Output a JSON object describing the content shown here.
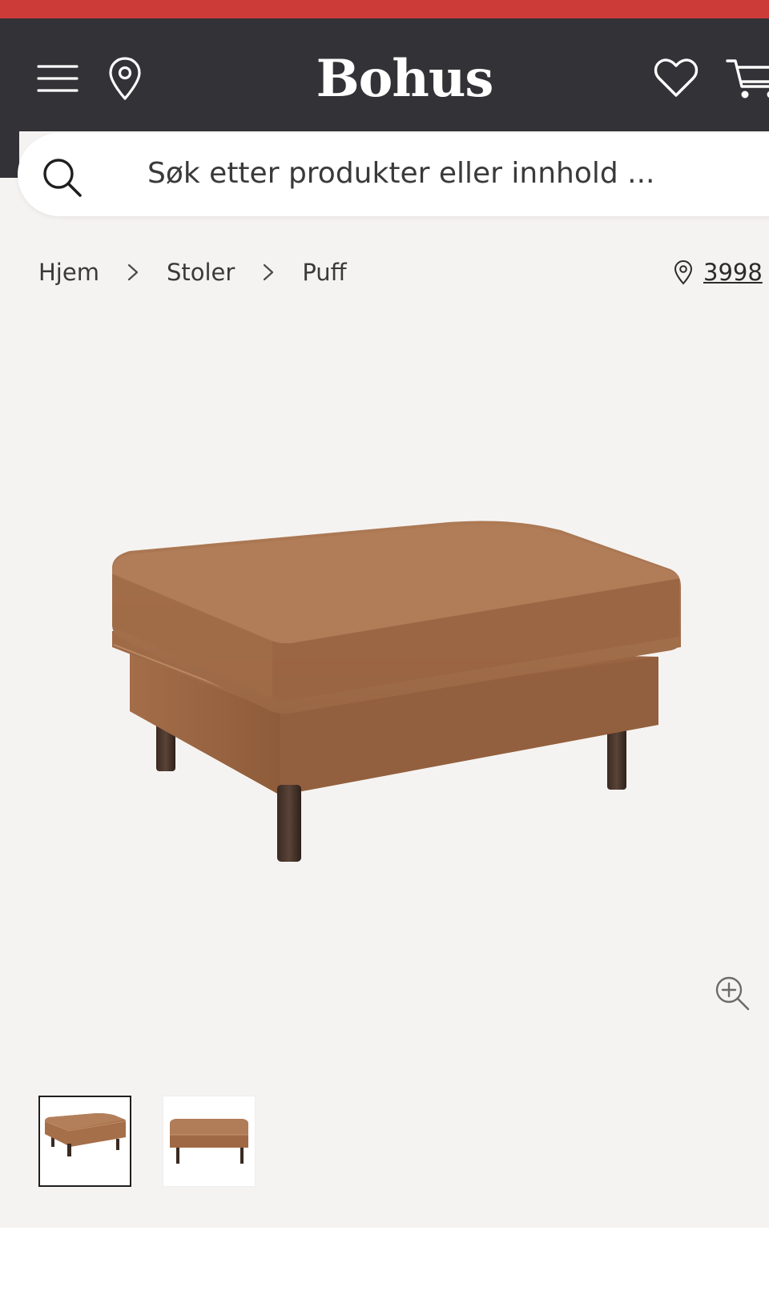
{
  "header": {
    "brand_name": "Bohus",
    "menu_icon": "hamburger-menu-icon",
    "store_icon": "location-pin-icon",
    "favorites_icon": "heart-icon",
    "cart_icon": "shopping-cart-icon",
    "colors": {
      "top_strip": "#cd3b39",
      "header_bg": "#333237",
      "logo": "#ffffff"
    }
  },
  "search": {
    "placeholder": "Søk etter produkter eller innhold ...",
    "value": "",
    "icon": "search-icon"
  },
  "breadcrumb": {
    "items": [
      "Hjem",
      "Stoler",
      "Puff"
    ],
    "separator_icon": "chevron-right-icon"
  },
  "store_selector": {
    "icon": "location-pin-icon",
    "label": "3998"
  },
  "product": {
    "main_image_alt": "Puff i brunt skinn",
    "zoom_icon": "zoom-in-icon",
    "thumbnails": [
      {
        "name": "thumbnail-1",
        "selected": true
      },
      {
        "name": "thumbnail-2",
        "selected": false
      }
    ]
  },
  "page": {
    "background": "#f5f3f1"
  }
}
